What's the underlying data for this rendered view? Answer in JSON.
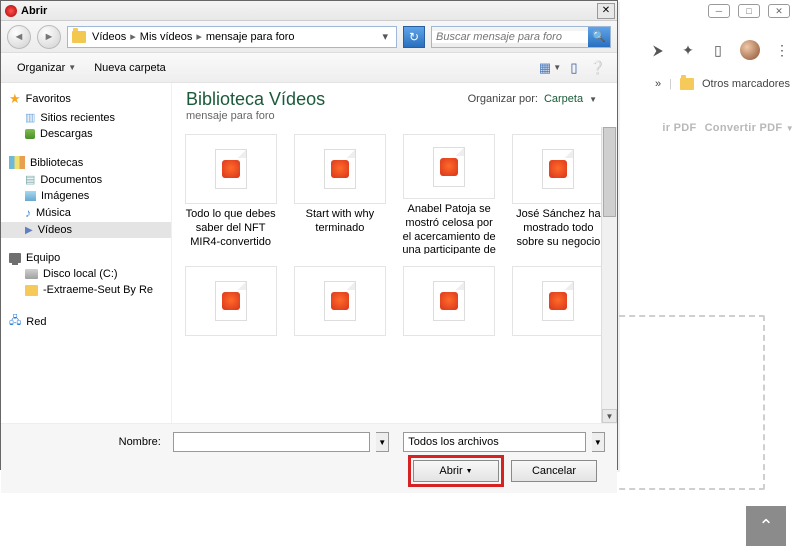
{
  "dialog": {
    "title": "Abrir",
    "breadcrumb": [
      "Vídeos",
      "Mis vídeos",
      "mensaje para foro"
    ],
    "search_placeholder": "Buscar mensaje para foro",
    "toolbar": {
      "organize": "Organizar",
      "new_folder": "Nueva carpeta"
    },
    "library": {
      "title": "Biblioteca Vídeos",
      "subtitle": "mensaje para foro",
      "organize_by_label": "Organizar por:",
      "organize_by_value": "Carpeta"
    },
    "files": [
      {
        "label": "Todo lo que debes saber del NFT MIR4-convertido"
      },
      {
        "label": "Start with why terminado"
      },
      {
        "label": "Anabel Patoja se mostró celosa por el acercamiento de una participante de"
      },
      {
        "label": "José Sánchez ha mostrado todo sobre su negocio"
      },
      {
        "label": ""
      },
      {
        "label": ""
      },
      {
        "label": ""
      },
      {
        "label": ""
      }
    ],
    "footer": {
      "name_label": "Nombre:",
      "filter": "Todos los archivos",
      "open": "Abrir",
      "cancel": "Cancelar"
    }
  },
  "sidebar": {
    "favorites": {
      "head": "Favoritos",
      "items": [
        "Sitios recientes",
        "Descargas"
      ]
    },
    "libraries": {
      "head": "Bibliotecas",
      "items": [
        "Documentos",
        "Imágenes",
        "Música",
        "Vídeos"
      ]
    },
    "computer": {
      "head": "Equipo",
      "items": [
        "Disco local (C:)",
        "-Extraeme-Seut By Re"
      ]
    },
    "network": {
      "head": "Red"
    }
  },
  "browser": {
    "bookmarks_label": "Otros marcadores",
    "pdf_actions": [
      "ir PDF",
      "Convertir PDF"
    ]
  }
}
